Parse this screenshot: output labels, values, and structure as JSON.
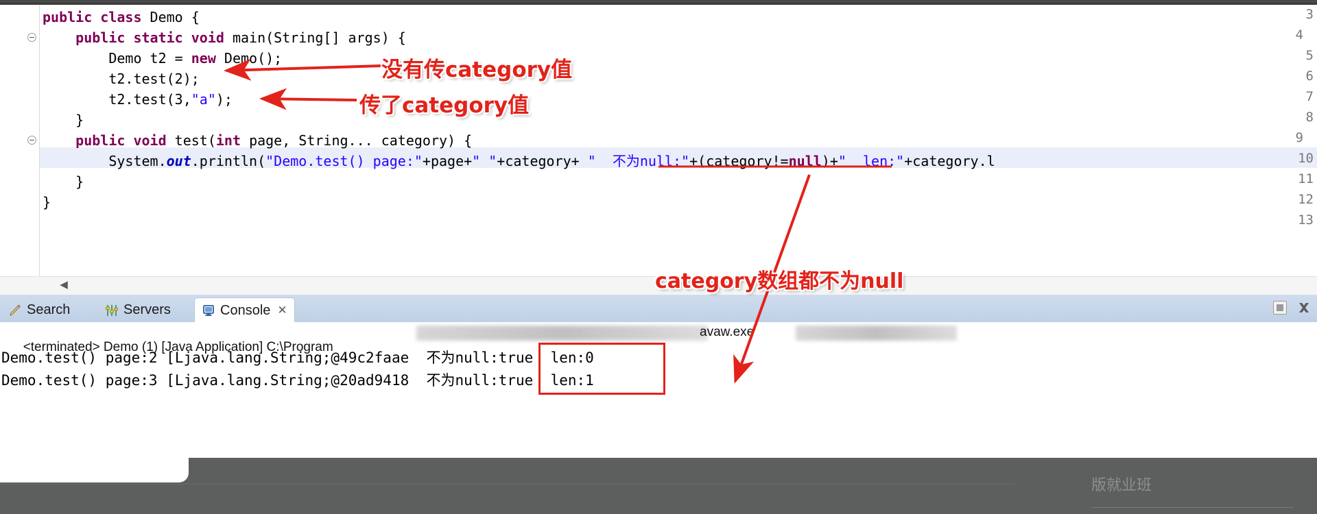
{
  "editor": {
    "lines": [
      {
        "num": "3",
        "fold": false,
        "indent": 0,
        "tokens": [
          {
            "t": "public ",
            "c": "kw"
          },
          {
            "t": "class ",
            "c": "kw"
          },
          {
            "t": "Demo {",
            "c": "plain"
          }
        ]
      },
      {
        "num": "4",
        "fold": true,
        "indent": 0,
        "tokens": [
          {
            "t": "    ",
            "c": "plain"
          },
          {
            "t": "public static void ",
            "c": "kw"
          },
          {
            "t": "main(String[] args) {",
            "c": "plain"
          }
        ]
      },
      {
        "num": "5",
        "fold": false,
        "indent": 0,
        "tokens": [
          {
            "t": "        Demo t2 = ",
            "c": "plain"
          },
          {
            "t": "new ",
            "c": "kw"
          },
          {
            "t": "Demo();",
            "c": "plain"
          }
        ]
      },
      {
        "num": "6",
        "fold": false,
        "indent": 0,
        "tokens": [
          {
            "t": "        t2.test(2);",
            "c": "plain"
          }
        ]
      },
      {
        "num": "7",
        "fold": false,
        "indent": 0,
        "tokens": [
          {
            "t": "        t2.test(3,",
            "c": "plain"
          },
          {
            "t": "\"a\"",
            "c": "str"
          },
          {
            "t": ");",
            "c": "plain"
          }
        ]
      },
      {
        "num": "8",
        "fold": false,
        "indent": 0,
        "tokens": [
          {
            "t": "    }",
            "c": "plain"
          }
        ]
      },
      {
        "num": "9",
        "fold": true,
        "indent": 0,
        "tokens": [
          {
            "t": "    ",
            "c": "plain"
          },
          {
            "t": "public void ",
            "c": "kw"
          },
          {
            "t": "test(",
            "c": "plain"
          },
          {
            "t": "int ",
            "c": "kw"
          },
          {
            "t": "page, String... category) {",
            "c": "plain"
          }
        ]
      },
      {
        "num": "10",
        "fold": false,
        "indent": 0,
        "tokens": [
          {
            "t": "        System.",
            "c": "plain"
          },
          {
            "t": "out",
            "c": "fld"
          },
          {
            "t": ".println(",
            "c": "plain"
          },
          {
            "t": "\"Demo.test() page:\"",
            "c": "str"
          },
          {
            "t": "+page+",
            "c": "plain"
          },
          {
            "t": "\" \"",
            "c": "str"
          },
          {
            "t": "+category+ ",
            "c": "plain"
          },
          {
            "t": "\"  不为null:\"",
            "c": "str"
          },
          {
            "t": "+(category!=",
            "c": "plain"
          },
          {
            "t": "null",
            "c": "kw"
          },
          {
            "t": ")+",
            "c": "plain"
          },
          {
            "t": "\"  len:\"",
            "c": "str"
          },
          {
            "t": "+category.l",
            "c": "plain"
          }
        ]
      },
      {
        "num": "11",
        "fold": false,
        "indent": 0,
        "tokens": [
          {
            "t": "    }",
            "c": "plain"
          }
        ]
      },
      {
        "num": "12",
        "fold": false,
        "indent": 0,
        "tokens": [
          {
            "t": "}",
            "c": "plain"
          }
        ]
      },
      {
        "num": "13",
        "fold": false,
        "indent": 0,
        "tokens": []
      }
    ],
    "scroll_left_arrow": "◀"
  },
  "view_tabs": {
    "tabs": [
      {
        "label": "Search",
        "icon": "pencil-icon",
        "active": false,
        "closable": false
      },
      {
        "label": "Servers",
        "icon": "servers-icon",
        "active": false,
        "closable": false
      },
      {
        "label": "Console",
        "icon": "console-icon",
        "active": true,
        "closable": true
      }
    ],
    "close_glyph": "✕",
    "toolbar": {
      "stop_label": "stop-icon",
      "close_label": "close-icon"
    }
  },
  "console": {
    "terminated_line_prefix": "<terminated> Demo (1) [Java Application] C:\\Program",
    "terminated_line_suffix": "avaw.exe",
    "output_lines": [
      {
        "left": "Demo.test() page:2 [Ljava.lang.String;@49c2faae",
        "boxed": "不为null:true",
        "right": "len:0"
      },
      {
        "left": "Demo.test() page:3 [Ljava.lang.String;@20ad9418",
        "boxed": "不为null:true",
        "right": "len:1"
      }
    ]
  },
  "annotations": [
    {
      "id": "a1",
      "text": "没有传category值"
    },
    {
      "id": "a2",
      "text": "传了category值"
    },
    {
      "id": "a3",
      "text": "category数组都不为null"
    }
  ],
  "bottom": {
    "watermark_text": "版就业班"
  },
  "colors": {
    "annotation_red": "#e2231a",
    "keyword_purple": "#7f0055",
    "string_blue": "#2a00ff",
    "field_blue": "#0000c0",
    "tab_bar_blue": "#c7d6ea",
    "gray_panel": "#5d5f5f"
  }
}
